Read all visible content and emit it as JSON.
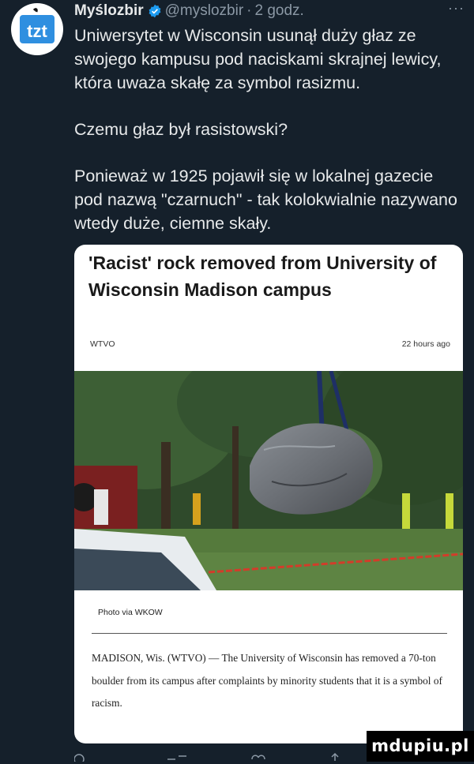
{
  "tweet": {
    "author": "Myślozbir",
    "handle": "@myslozbir",
    "separator": "·",
    "time": "2 godz.",
    "more_label": "···",
    "avatar_text": "tzt",
    "paragraphs": [
      "Uniwersytet w Wisconsin usunął duży głaz ze swojego kampusu pod naciskami skrajnej lewicy, która uważa skałę za symbol rasizmu.",
      "Czemu głaz był rasistowski?",
      "Ponieważ w 1925 pojawił się w lokalnej gazecie pod nazwą \"czarnuch\" - tak kolokwialnie nazywano wtedy duże, ciemne skały."
    ]
  },
  "card": {
    "title": "'Racist' rock removed from University of Wisconsin Madison campus",
    "source": "WTVO",
    "age": "22 hours ago",
    "photo_caption": "Photo via WKOW",
    "article_text": "MADISON, Wis. (WTVO) — The University of Wisconsin has removed a 70-ton boulder from its campus after complaints by minority students that it is a symbol of racism."
  },
  "watermark": "mdupiu.pl",
  "colors": {
    "background": "#15202b",
    "text": "#e7e9ea",
    "secondary_text": "#8b98a5",
    "verified": "#1d9bf0",
    "card_bg": "#ffffff"
  },
  "icons": [
    "verified-badge-icon",
    "more-icon",
    "reply-icon",
    "retweet-icon",
    "like-icon",
    "share-icon"
  ]
}
